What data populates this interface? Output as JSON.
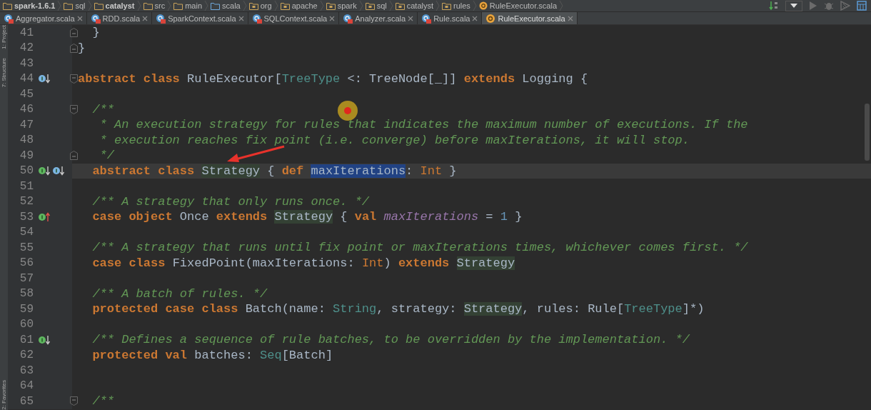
{
  "breadcrumbs": [
    {
      "label": "spark-1.6.1",
      "kind": "project",
      "bold": true
    },
    {
      "label": "sql",
      "kind": "folder",
      "bold": false
    },
    {
      "label": "catalyst",
      "kind": "module",
      "bold": true
    },
    {
      "label": "src",
      "kind": "folder",
      "bold": false
    },
    {
      "label": "main",
      "kind": "folder",
      "bold": false
    },
    {
      "label": "scala",
      "kind": "source",
      "bold": false
    },
    {
      "label": "org",
      "kind": "package",
      "bold": false
    },
    {
      "label": "apache",
      "kind": "package",
      "bold": false
    },
    {
      "label": "spark",
      "kind": "package",
      "bold": false
    },
    {
      "label": "sql",
      "kind": "package",
      "bold": false
    },
    {
      "label": "catalyst",
      "kind": "package",
      "bold": false
    },
    {
      "label": "rules",
      "kind": "package",
      "bold": false
    },
    {
      "label": "RuleExecutor.scala",
      "kind": "object",
      "bold": false
    }
  ],
  "tool_windows": {
    "top": [
      "1: Project",
      "7: Structure"
    ],
    "bottom": [
      "2: Favorites"
    ]
  },
  "tabs": [
    {
      "label": "Aggregator.scala",
      "kind": "class",
      "selected": false
    },
    {
      "label": "RDD.scala",
      "kind": "class",
      "selected": false
    },
    {
      "label": "SparkContext.scala",
      "kind": "class",
      "selected": false
    },
    {
      "label": "SQLContext.scala",
      "kind": "class",
      "selected": false
    },
    {
      "label": "Analyzer.scala",
      "kind": "class",
      "selected": false
    },
    {
      "label": "Rule.scala",
      "kind": "class",
      "selected": false
    },
    {
      "label": "RuleExecutor.scala",
      "kind": "object",
      "selected": true
    }
  ],
  "lines": [
    {
      "number": "41",
      "current": false,
      "fold": {
        "kind": "end"
      },
      "tokens": [
        {
          "kind": "text",
          "t": "  }"
        }
      ]
    },
    {
      "number": "42",
      "current": false,
      "fold": {
        "kind": "end"
      },
      "tokens": [
        {
          "kind": "text",
          "t": "}"
        }
      ]
    },
    {
      "number": "43",
      "current": false
    },
    {
      "number": "44",
      "current": false,
      "fold": {
        "kind": "start"
      },
      "markers": [
        {
          "kind": "override"
        }
      ],
      "tokens": [
        {
          "kind": "kw",
          "t": "abstract class "
        },
        {
          "kind": "text",
          "t": "RuleExecutor["
        },
        {
          "kind": "type",
          "t": "TreeType"
        },
        {
          "kind": "text",
          "t": " <: TreeNode[_]] "
        },
        {
          "kind": "kw",
          "t": "extends"
        },
        {
          "kind": "text",
          "t": " Logging {"
        }
      ]
    },
    {
      "number": "45",
      "current": false
    },
    {
      "number": "46",
      "current": false,
      "fold": {
        "kind": "start"
      },
      "tokens": [
        {
          "kind": "comment",
          "t": "  /**"
        }
      ]
    },
    {
      "number": "47",
      "current": false,
      "tokens": [
        {
          "kind": "comment",
          "t": "   * An execution strategy for rules that indicates the maximum number of executions. If the"
        }
      ]
    },
    {
      "number": "48",
      "current": false,
      "tokens": [
        {
          "kind": "comment",
          "t": "   * execution reaches fix point (i.e. converge) before maxIterations, it will stop."
        }
      ]
    },
    {
      "number": "49",
      "current": false,
      "fold": {
        "kind": "end"
      },
      "tokens": [
        {
          "kind": "comment",
          "t": "   */"
        }
      ]
    },
    {
      "number": "50",
      "current": true,
      "markers": [
        {
          "kind": "implemented"
        },
        {
          "kind": "override"
        }
      ],
      "tokens": [
        {
          "kind": "kw",
          "t": "  abstract class "
        },
        {
          "kind": "usage",
          "t": "Strategy"
        },
        {
          "kind": "text",
          "t": " { "
        },
        {
          "kind": "kw",
          "t": "def "
        },
        {
          "kind": "selection",
          "t": "maxIterations"
        },
        {
          "kind": "text",
          "t": ": "
        },
        {
          "kind": "builtin",
          "t": "Int"
        },
        {
          "kind": "text",
          "t": " }"
        }
      ]
    },
    {
      "number": "51",
      "current": false
    },
    {
      "number": "52",
      "current": false,
      "tokens": [
        {
          "kind": "comment",
          "t": "  /** A strategy that only runs once. */"
        }
      ]
    },
    {
      "number": "53",
      "current": false,
      "markers": [
        {
          "kind": "implements"
        }
      ],
      "tokens": [
        {
          "kind": "kw",
          "t": "  case object "
        },
        {
          "kind": "text",
          "t": "Once "
        },
        {
          "kind": "kw",
          "t": "extends "
        },
        {
          "kind": "usage",
          "t": "Strategy"
        },
        {
          "kind": "text",
          "t": " { "
        },
        {
          "kind": "kw",
          "t": "val "
        },
        {
          "kind": "field",
          "t": "maxIterations"
        },
        {
          "kind": "text",
          "t": " = "
        },
        {
          "kind": "number",
          "t": "1"
        },
        {
          "kind": "text",
          "t": " }"
        }
      ]
    },
    {
      "number": "54",
      "current": false
    },
    {
      "number": "55",
      "current": false,
      "tokens": [
        {
          "kind": "comment",
          "t": "  /** A strategy that runs until fix point or maxIterations times, whichever comes first. */"
        }
      ]
    },
    {
      "number": "56",
      "current": false,
      "tokens": [
        {
          "kind": "kw",
          "t": "  case class "
        },
        {
          "kind": "text",
          "t": "FixedPoint(maxIterations: "
        },
        {
          "kind": "builtin",
          "t": "Int"
        },
        {
          "kind": "text",
          "t": ") "
        },
        {
          "kind": "kw",
          "t": "extends "
        },
        {
          "kind": "usage",
          "t": "Strategy"
        }
      ]
    },
    {
      "number": "57",
      "current": false
    },
    {
      "number": "58",
      "current": false,
      "tokens": [
        {
          "kind": "comment",
          "t": "  /** A batch of rules. */"
        }
      ]
    },
    {
      "number": "59",
      "current": false,
      "tokens": [
        {
          "kind": "kw",
          "t": "  protected case class "
        },
        {
          "kind": "text",
          "t": "Batch(name: "
        },
        {
          "kind": "type",
          "t": "String"
        },
        {
          "kind": "text",
          "t": ", strategy: "
        },
        {
          "kind": "usage",
          "t": "Strategy"
        },
        {
          "kind": "text",
          "t": ", rules: Rule["
        },
        {
          "kind": "type",
          "t": "TreeType"
        },
        {
          "kind": "text",
          "t": "]*)"
        }
      ]
    },
    {
      "number": "60",
      "current": false
    },
    {
      "number": "61",
      "current": false,
      "markers": [
        {
          "kind": "implemented"
        }
      ],
      "tokens": [
        {
          "kind": "comment",
          "t": "  /** Defines a sequence of rule batches, to be overridden by the implementation. */"
        }
      ]
    },
    {
      "number": "62",
      "current": false,
      "tokens": [
        {
          "kind": "kw",
          "t": "  protected val "
        },
        {
          "kind": "text",
          "t": "batches: "
        },
        {
          "kind": "type",
          "t": "Seq"
        },
        {
          "kind": "text",
          "t": "[Batch]"
        }
      ]
    },
    {
      "number": "63",
      "current": false
    },
    {
      "number": "64",
      "current": false
    },
    {
      "number": "65",
      "current": false,
      "fold": {
        "kind": "start"
      },
      "tokens": [
        {
          "kind": "comment",
          "t": "  /**"
        }
      ]
    }
  ]
}
